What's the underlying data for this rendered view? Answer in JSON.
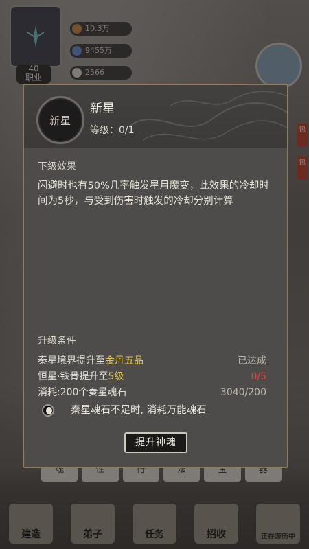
{
  "background": {
    "level_value": "40",
    "level_caption": "职业",
    "resources": [
      {
        "icon": "copper-coin-icon",
        "value": "10.3万"
      },
      {
        "icon": "spirit-stone-icon",
        "value": "9455万"
      },
      {
        "icon": "yin-yang-icon",
        "value": "2566"
      }
    ],
    "side_labels": [
      "包",
      "包"
    ],
    "tabs": [
      "魂",
      "性",
      "行",
      "法",
      "宝",
      "器"
    ],
    "nav": [
      "建造",
      "弟子",
      "任务",
      "招收",
      "正在游历中"
    ]
  },
  "skill": {
    "icon_text": "新星",
    "name": "新星",
    "level_label": "等级：",
    "level_value": "0/1"
  },
  "next_effect": {
    "title": "下级效果",
    "description": "闪避时也有50%几率触发星月魔变，此效果的冷却时间为5秒，与受到伤害时触发的冷却分别计算"
  },
  "conditions": {
    "title": "升级条件",
    "rows": [
      {
        "prefix": "秦星境界提升至",
        "highlight": "金丹五品",
        "suffix": "",
        "value": "已达成",
        "highlight_color": "#e8c64a",
        "value_color": "#bdb7ae"
      },
      {
        "prefix": "恒星·铁骨提升至",
        "highlight": "5级",
        "suffix": "",
        "value": "0/5",
        "highlight_color": "#e8c64a",
        "value_color": "#e0433a"
      },
      {
        "prefix": "消耗:200个秦星魂石",
        "highlight": "",
        "suffix": "",
        "value": "3040/200",
        "highlight_color": "#e8c64a",
        "value_color": "#bdb7ae"
      }
    ]
  },
  "option": {
    "label": "秦星魂石不足时, 消耗万能魂石",
    "enabled": true
  },
  "upgrade_button": "提升神魂"
}
